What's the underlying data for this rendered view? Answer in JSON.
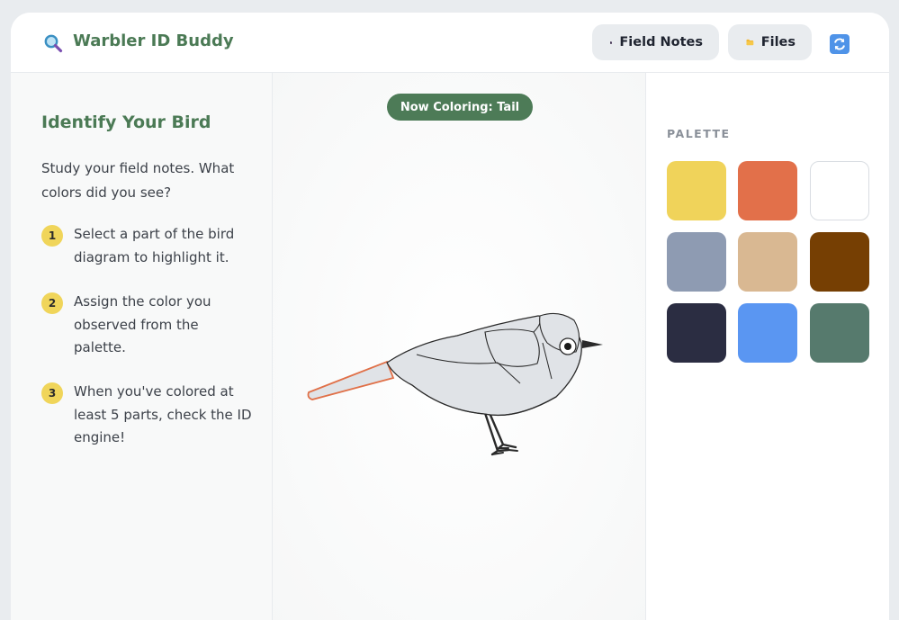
{
  "header": {
    "app_title": "Warbler ID Buddy",
    "logo_icon": "magnifying-glass-icon",
    "field_notes_label": "Field Notes",
    "field_notes_icon": "notebook-icon",
    "files_label": "Files",
    "files_icon": "folder-icon",
    "refresh_icon": "refresh-icon"
  },
  "sidebar": {
    "title": "Identify Your Bird",
    "intro": "Study your field notes. What colors did you see?",
    "steps": [
      {
        "num": "1",
        "text": "Select a part of the bird diagram to highlight it."
      },
      {
        "num": "2",
        "text": "Assign the color you observed from the palette."
      },
      {
        "num": "3",
        "text": "When you've colored at least 5 parts, check the ID engine!"
      }
    ]
  },
  "canvas": {
    "badge": "Now Coloring: Tail",
    "selected_part": "tail",
    "highlight_color": "#e07048",
    "unpainted_color": "#e0e3e7"
  },
  "palette": {
    "label": "PALETTE",
    "colors": [
      "#f0d35a",
      "#e2704a",
      "#ffffff",
      "#8e9bb2",
      "#d9b892",
      "#763f03",
      "#2b2d42",
      "#5a96f2",
      "#567a6d"
    ]
  }
}
